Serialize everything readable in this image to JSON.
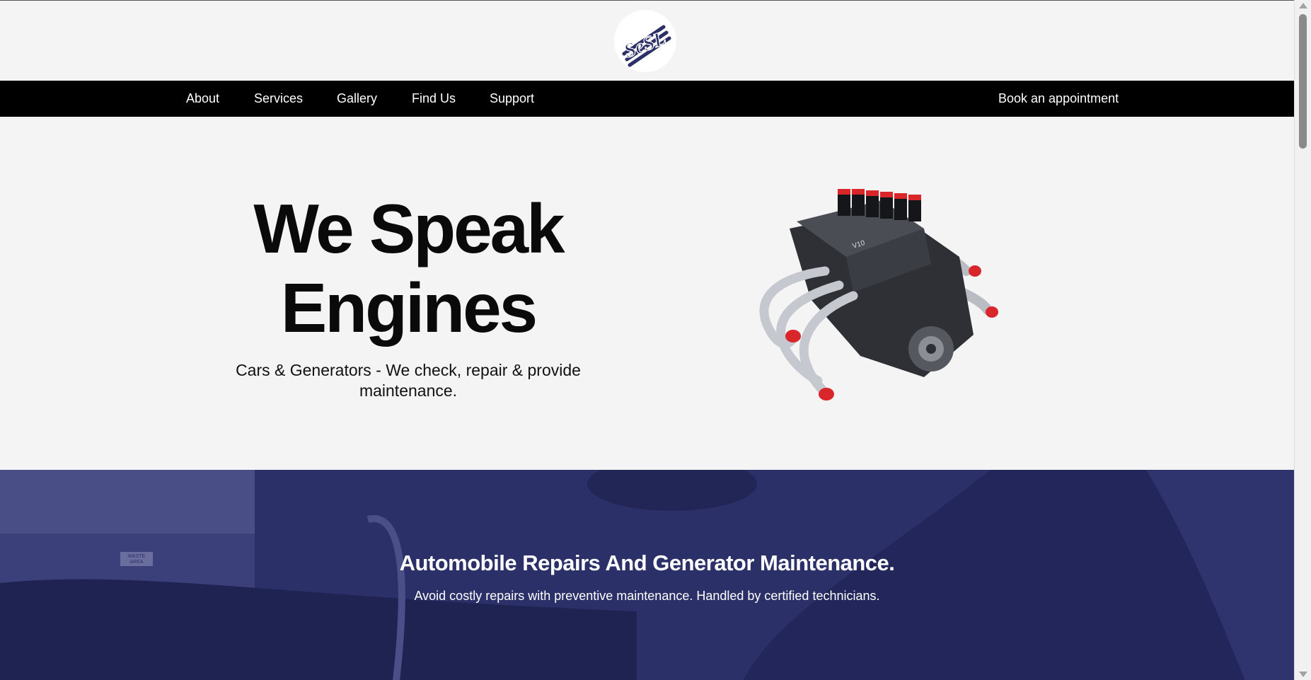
{
  "brand": {
    "logo_text": "SeSL",
    "accent_color": "#2b2f66"
  },
  "nav": {
    "items": [
      {
        "label": "About"
      },
      {
        "label": "Services"
      },
      {
        "label": "Gallery"
      },
      {
        "label": "Find Us"
      },
      {
        "label": "Support"
      }
    ],
    "cta_label": "Book an appointment"
  },
  "hero": {
    "title_line1": "We Speak",
    "title_line2": "Engines",
    "subtitle": "Cars & Generators - We check, repair & provide maintenance.",
    "image_icon": "engine-image"
  },
  "banner": {
    "title": "Automobile Repairs And Generator Maintenance.",
    "subtitle": "Avoid costly repairs with preventive maintenance. Handled by certified technicians.",
    "sign_text": "WASTE AREA"
  }
}
